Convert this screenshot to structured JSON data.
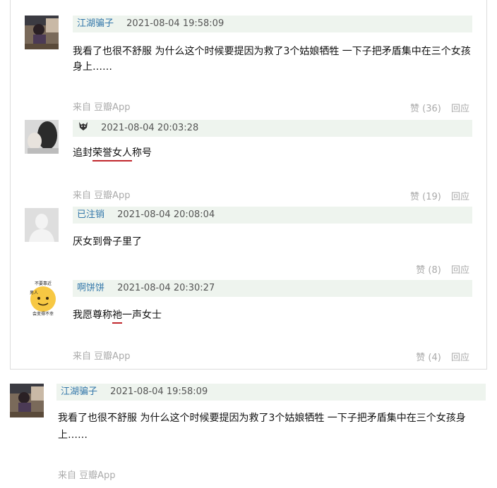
{
  "comments": [
    {
      "user": "江湖骗子",
      "time": "2021-08-04 19:58:09",
      "text": "我看了也很不舒服 为什么这个时候要提因为救了3个姑娘牺牲 一下子把矛盾集中在三个女孩身上……",
      "source": "来自 豆瓣App",
      "likes": "赞 (36)",
      "reply": "回应"
    },
    {
      "user": "",
      "time": "2021-08-04 20:03:28",
      "text_a": "追封",
      "text_b": "荣誉女人",
      "text_c": "称号",
      "source": "来自 豆瓣App",
      "likes": "赞 (19)",
      "reply": "回应"
    },
    {
      "user": "已注销",
      "time": "2021-08-04 20:08:04",
      "text": "厌女到骨子里了",
      "likes": "赞 (8)",
      "reply": "回应"
    },
    {
      "user": "啊饼饼",
      "time": "2021-08-04 20:30:27",
      "text_a": "我愿尊称",
      "text_b": "祂",
      "text_c": "一声女士",
      "avatar_text_top": "不要靠近",
      "avatar_text_mid": "男人",
      "avatar_text_bottom": "会变得不幸",
      "source": "来自 豆瓣App",
      "likes": "赞 (4)",
      "reply": "回应"
    },
    {
      "user": "江湖骗子",
      "time": "2021-08-04 19:58:09",
      "text_line1": "我看了也很不舒服 为什么这个时候要提因为救了3个姑娘牺牲 一下子把矛盾集中在三个女孩身",
      "text_line2": "上……",
      "source": "来自 豆瓣App"
    }
  ],
  "colors": {
    "username": "#3377aa",
    "meta_bg": "#eef4ee",
    "muted": "#aaaaaa",
    "underline": "#c1272d"
  }
}
